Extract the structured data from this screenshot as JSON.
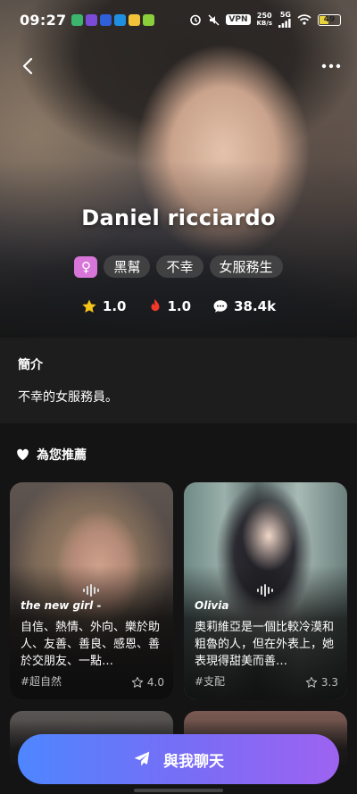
{
  "status_bar": {
    "time": "09:27",
    "network_speed_value": "250",
    "network_speed_unit": "KB/s",
    "vpn_label": "VPN",
    "signal_label": "5G",
    "battery_level": "49"
  },
  "character": {
    "name": "Daniel ricciardo",
    "gender_symbol": "♀",
    "tags": [
      "黑幫",
      "不幸",
      "女服務生"
    ],
    "rating": "1.0",
    "popularity": "1.0",
    "chat_count": "38.4k"
  },
  "intro": {
    "heading": "簡介",
    "text": "不幸的女服務員。"
  },
  "recommend": {
    "heading": "為您推薦",
    "cards": [
      {
        "title": "the new girl -",
        "description": "自信、熱情、外向、樂於助人、友善、善良、感恩、善於交朋友、一點…",
        "tag": "#超自然",
        "rating": "4.0"
      },
      {
        "title": "Olivia",
        "description": "奧莉維亞是一個比較冷漠和粗魯的人，但在外表上，她表現得甜美而善…",
        "tag": "#支配",
        "rating": "3.3"
      }
    ]
  },
  "chat_button": {
    "label": "與我聊天"
  },
  "colors": {
    "accent_start": "#4e86ff",
    "accent_end": "#9d63f1",
    "gender_badge": "#d775d8",
    "star": "#f5c518",
    "fire": "#f0382b"
  }
}
